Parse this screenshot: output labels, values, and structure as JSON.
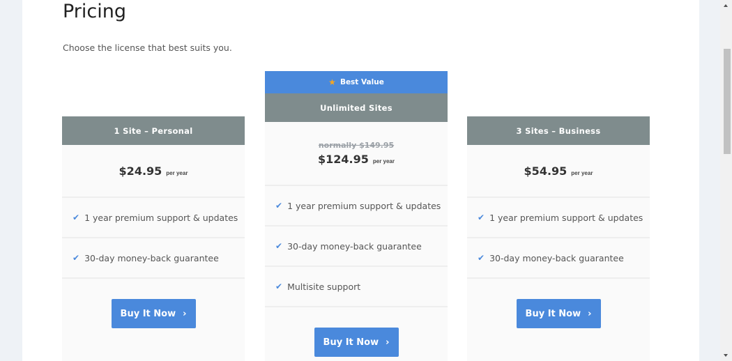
{
  "page": {
    "title": "Pricing",
    "subtitle": "Choose the license that best suits you."
  },
  "colors": {
    "accent": "#4a89dc",
    "header_gray": "#7f8c8d",
    "star": "#f5a623"
  },
  "plans": [
    {
      "name": "1 Site – Personal",
      "price": "$24.95",
      "period": "per year",
      "features": [
        "1 year premium support & updates",
        "30-day money-back guarantee"
      ],
      "button": "Buy It Now",
      "button_icon": "chevron-right-icon"
    },
    {
      "badge": "Best Value",
      "badge_icon": "star-icon",
      "name": "Unlimited Sites",
      "original_price": "normally $149.95",
      "price": "$124.95",
      "period": "per year",
      "features": [
        "1 year premium support & updates",
        "30-day money-back guarantee",
        "Multisite support"
      ],
      "button": "Buy It Now",
      "button_icon": "chevron-right-icon"
    },
    {
      "name": "3 Sites – Business",
      "price": "$54.95",
      "period": "per year",
      "features": [
        "1 year premium support & updates",
        "30-day money-back guarantee"
      ],
      "button": "Buy It Now",
      "button_icon": "chevron-right-icon"
    }
  ],
  "icons": {
    "check": "✔",
    "star": "★",
    "chevron": "›"
  }
}
